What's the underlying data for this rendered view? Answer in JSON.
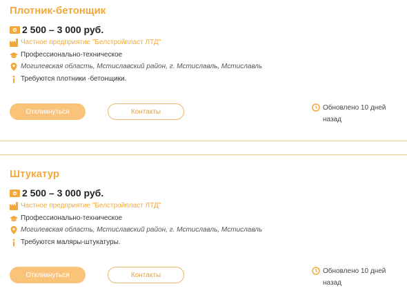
{
  "colors": {
    "accent": "#f2a93b",
    "button_fill": "#f9c47a",
    "separator": "#e9c98e"
  },
  "vacancies": [
    {
      "title": "Плотник-бетонщик",
      "salary": "2 500 – 3 000 руб.",
      "company": "Частное предприятие \"Белстройпласт ЛТД\"",
      "education": "Профессионально-техническое",
      "address": "Могилевская область, Мстиславский район, г. Мстиславль, Мстиславль",
      "info": "Требуются плотники -бетонщики.",
      "respond_label": "Откликнуться",
      "contacts_label": "Контакты",
      "updated": "Обновлено 10 дней назад"
    },
    {
      "title": "Штукатур",
      "salary": "2 500 – 3 000 руб.",
      "company": "Частное предприятие \"Белстройпласт ЛТД\"",
      "education": "Профессионально-техническое",
      "address": "Могилевская область, Мстиславский район, г. Мстиславль, Мстиславль",
      "info": "Требуются маляры-штукатуры.",
      "respond_label": "Откликнуться",
      "contacts_label": "Контакты",
      "updated": "Обновлено 10 дней назад"
    }
  ],
  "icons": [
    "money-icon",
    "factory-icon",
    "graduation-cap-icon",
    "location-pin-icon",
    "info-icon",
    "clock-icon"
  ]
}
